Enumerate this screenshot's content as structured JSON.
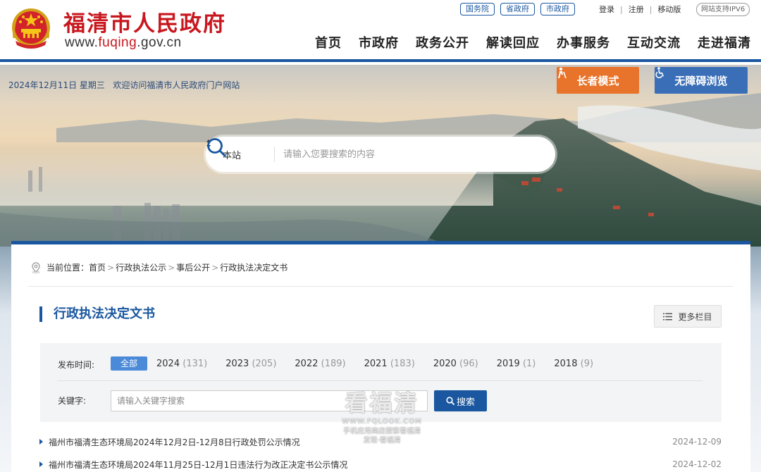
{
  "header": {
    "site_title": "福清市人民政府",
    "site_url_prefix": "www.",
    "site_url_accent": "fuqing",
    "site_url_suffix": ".gov.cn",
    "top_links": [
      "国务院",
      "省政府",
      "市政府"
    ],
    "user_links": {
      "login": "登录",
      "register": "注册",
      "mobile": "移动版",
      "separator": "|"
    },
    "ipv6": "网站支持IPV6",
    "nav": [
      "首页",
      "市政府",
      "政务公开",
      "解读回应",
      "办事服务",
      "互动交流",
      "走进福清"
    ],
    "brand_color": "#1a57a0",
    "title_color": "#c8171e"
  },
  "banner": {
    "date_text": "2024年12月11日 星期三",
    "welcome_text": "欢迎访问福清市人民政府门户网站",
    "elder_mode": "长者模式",
    "accessible": "无障碍浏览",
    "search_scope": "本站",
    "search_placeholder": "请输入您要搜索的内容"
  },
  "breadcrumb": {
    "label": "当前位置：",
    "items": [
      "首页",
      "行政执法公示",
      "事后公开",
      "行政执法决定文书"
    ],
    "separator": ">"
  },
  "section": {
    "title": "行政执法决定文书",
    "more_button": "更多栏目"
  },
  "filter": {
    "time_label": "发布时间:",
    "all_label": "全部",
    "years": [
      {
        "year": "2024",
        "count": "(131)"
      },
      {
        "year": "2023",
        "count": "(205)"
      },
      {
        "year": "2022",
        "count": "(189)"
      },
      {
        "year": "2021",
        "count": "(183)"
      },
      {
        "year": "2020",
        "count": "(96)"
      },
      {
        "year": "2019",
        "count": "(1)"
      },
      {
        "year": "2018",
        "count": "(9)"
      }
    ],
    "keyword_label": "关键字:",
    "keyword_placeholder": "请输入关键字搜索",
    "search_button": "搜索"
  },
  "list": [
    {
      "title": "福州市福清生态环境局2024年12月2日-12月8日行政处罚公示情况",
      "date": "2024-12-09"
    },
    {
      "title": "福州市福清生态环境局2024年11月25日-12月1日违法行为改正决定书公示情况",
      "date": "2024-12-02"
    }
  ],
  "watermark": {
    "big": "看福清",
    "url": "WWW.FQLOOK.COM",
    "line1": "手机应用商店搜索看福清",
    "line2": "发现·看福清"
  }
}
